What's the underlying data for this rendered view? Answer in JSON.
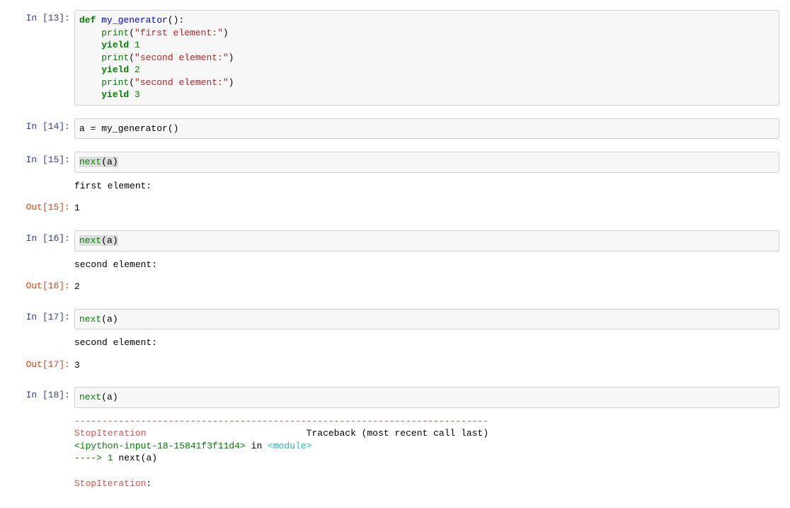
{
  "prompts": {
    "in13": "In [13]:",
    "in14": "In [14]:",
    "in15": "In [15]:",
    "out15": "Out[15]:",
    "in16": "In [16]:",
    "out16": "Out[16]:",
    "in17": "In [17]:",
    "out17": "Out[17]:",
    "in18": "In [18]:"
  },
  "cells": {
    "c13": {
      "tokens": {
        "def": "def",
        "sp1": " ",
        "fn": "my_generator",
        "op": "(",
        "cp": ")",
        "colon": ":",
        "indent": "    ",
        "print": "print",
        "s1": "\"first element:\"",
        "yield": "yield",
        "n1": "1",
        "s2": "\"second element:\"",
        "n2": "2",
        "s3": "\"second element:\"",
        "n3": "3"
      }
    },
    "c14": {
      "tokens": {
        "a": "a",
        "eq": " = ",
        "fn": "my_generator",
        "op": "(",
        "cp": ")"
      }
    },
    "c15": {
      "tokens": {
        "next": "next",
        "op": "(",
        "a": "a",
        "cp": ")"
      },
      "stdout": "first element:",
      "result": "1"
    },
    "c16": {
      "tokens": {
        "next": "next",
        "op": "(",
        "a": "a",
        "cp": ")"
      },
      "stdout": "second element:",
      "result": "2"
    },
    "c17": {
      "tokens": {
        "next": "next",
        "op": "(",
        "a": "a",
        "cp": ")"
      },
      "stdout": "second element:",
      "result": "3"
    },
    "c18": {
      "tokens": {
        "next": "next",
        "op": "(",
        "a": "a",
        "cp": ")"
      },
      "err": {
        "sep": "---------------------------------------------------------------------------",
        "exc": "StopIteration",
        "tb_label": "Traceback (most recent call last)",
        "loc_pre": "<ipython-input-18-15841f3f11d4>",
        "loc_in": " in ",
        "loc_mod": "<module>",
        "arrow": "----> 1",
        "call_next": " next",
        "call_op": "(",
        "call_a": "a",
        "call_cp": ")",
        "final": "StopIteration",
        "final_colon": ": "
      }
    }
  }
}
